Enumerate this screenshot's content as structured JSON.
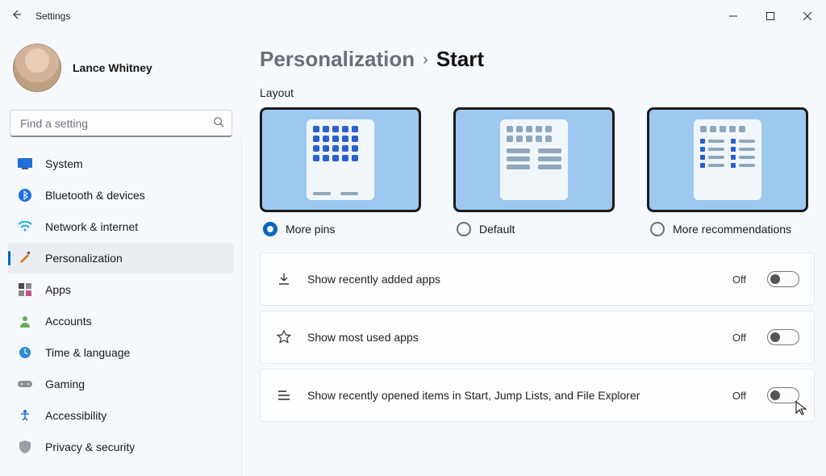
{
  "window": {
    "title": "Settings"
  },
  "user": {
    "name": "Lance Whitney"
  },
  "search": {
    "placeholder": "Find a setting"
  },
  "sidebar": {
    "items": [
      {
        "label": "System"
      },
      {
        "label": "Bluetooth & devices"
      },
      {
        "label": "Network & internet"
      },
      {
        "label": "Personalization"
      },
      {
        "label": "Apps"
      },
      {
        "label": "Accounts"
      },
      {
        "label": "Time & language"
      },
      {
        "label": "Gaming"
      },
      {
        "label": "Accessibility"
      },
      {
        "label": "Privacy & security"
      }
    ],
    "selected_index": 3
  },
  "breadcrumb": {
    "parent": "Personalization",
    "current": "Start"
  },
  "layout": {
    "section_label": "Layout",
    "options": [
      {
        "label": "More pins"
      },
      {
        "label": "Default"
      },
      {
        "label": "More recommendations"
      }
    ],
    "selected_index": 0
  },
  "settings": [
    {
      "icon": "download-icon",
      "label": "Show recently added apps",
      "state": "Off",
      "value": false
    },
    {
      "icon": "star-icon",
      "label": "Show most used apps",
      "state": "Off",
      "value": false
    },
    {
      "icon": "list-icon",
      "label": "Show recently opened items in Start, Jump Lists, and File Explorer",
      "state": "Off",
      "value": false
    }
  ]
}
